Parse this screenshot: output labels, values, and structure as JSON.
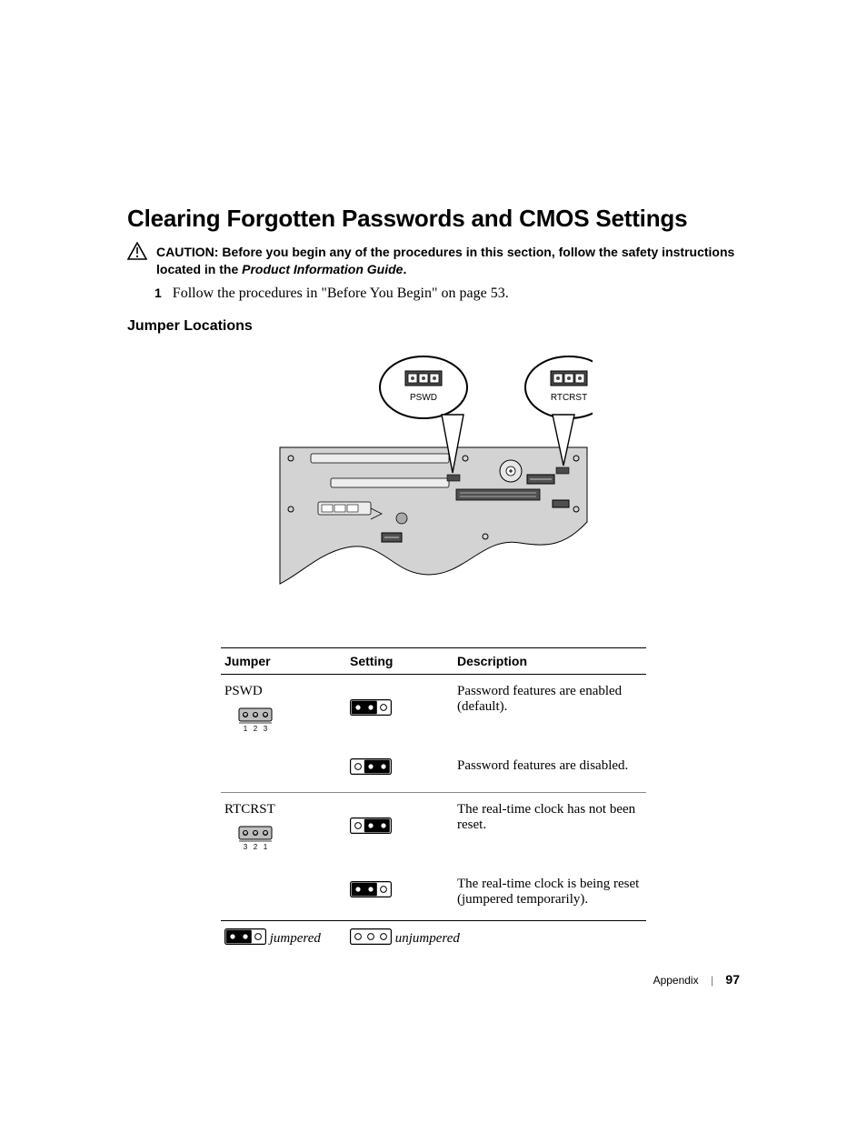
{
  "title": "Clearing Forgotten Passwords and CMOS Settings",
  "caution": {
    "prefix": "CAUTION:",
    "body_a": " Before you begin any of the procedures in this section, follow the safety instructions located in the ",
    "guide": "Product Information Guide",
    "body_b": "."
  },
  "steps": [
    {
      "num": "1",
      "text": "Follow the procedures in \"Before You Begin\" on page 53."
    }
  ],
  "subheading": "Jumper Locations",
  "diagram": {
    "callouts": {
      "left": "PSWD",
      "right": "RTCRST"
    }
  },
  "table": {
    "headers": {
      "jumper": "Jumper",
      "setting": "Setting",
      "description": "Description"
    },
    "rows": [
      {
        "jumper_name": "PSWD",
        "pin_labels": [
          "1",
          "2",
          "3"
        ],
        "setting_fill": [
          true,
          true,
          false
        ],
        "description": "Password features are enabled (default)."
      },
      {
        "jumper_name": "",
        "setting_fill": [
          false,
          true,
          true
        ],
        "description": "Password features are disabled."
      },
      {
        "jumper_name": "RTCRST",
        "pin_labels": [
          "3",
          "2",
          "1"
        ],
        "setting_fill": [
          false,
          true,
          true
        ],
        "description": "The real-time clock has not been reset."
      },
      {
        "jumper_name": "",
        "setting_fill": [
          true,
          true,
          false
        ],
        "description": "The real-time clock is being reset (jumpered temporarily)."
      }
    ],
    "legend": {
      "jumpered_fill": [
        true,
        true,
        false
      ],
      "jumpered_label": "jumpered",
      "unjumpered_fill": [
        false,
        false,
        false
      ],
      "unjumpered_label": "unjumpered"
    }
  },
  "footer": {
    "section": "Appendix",
    "page": "97"
  }
}
